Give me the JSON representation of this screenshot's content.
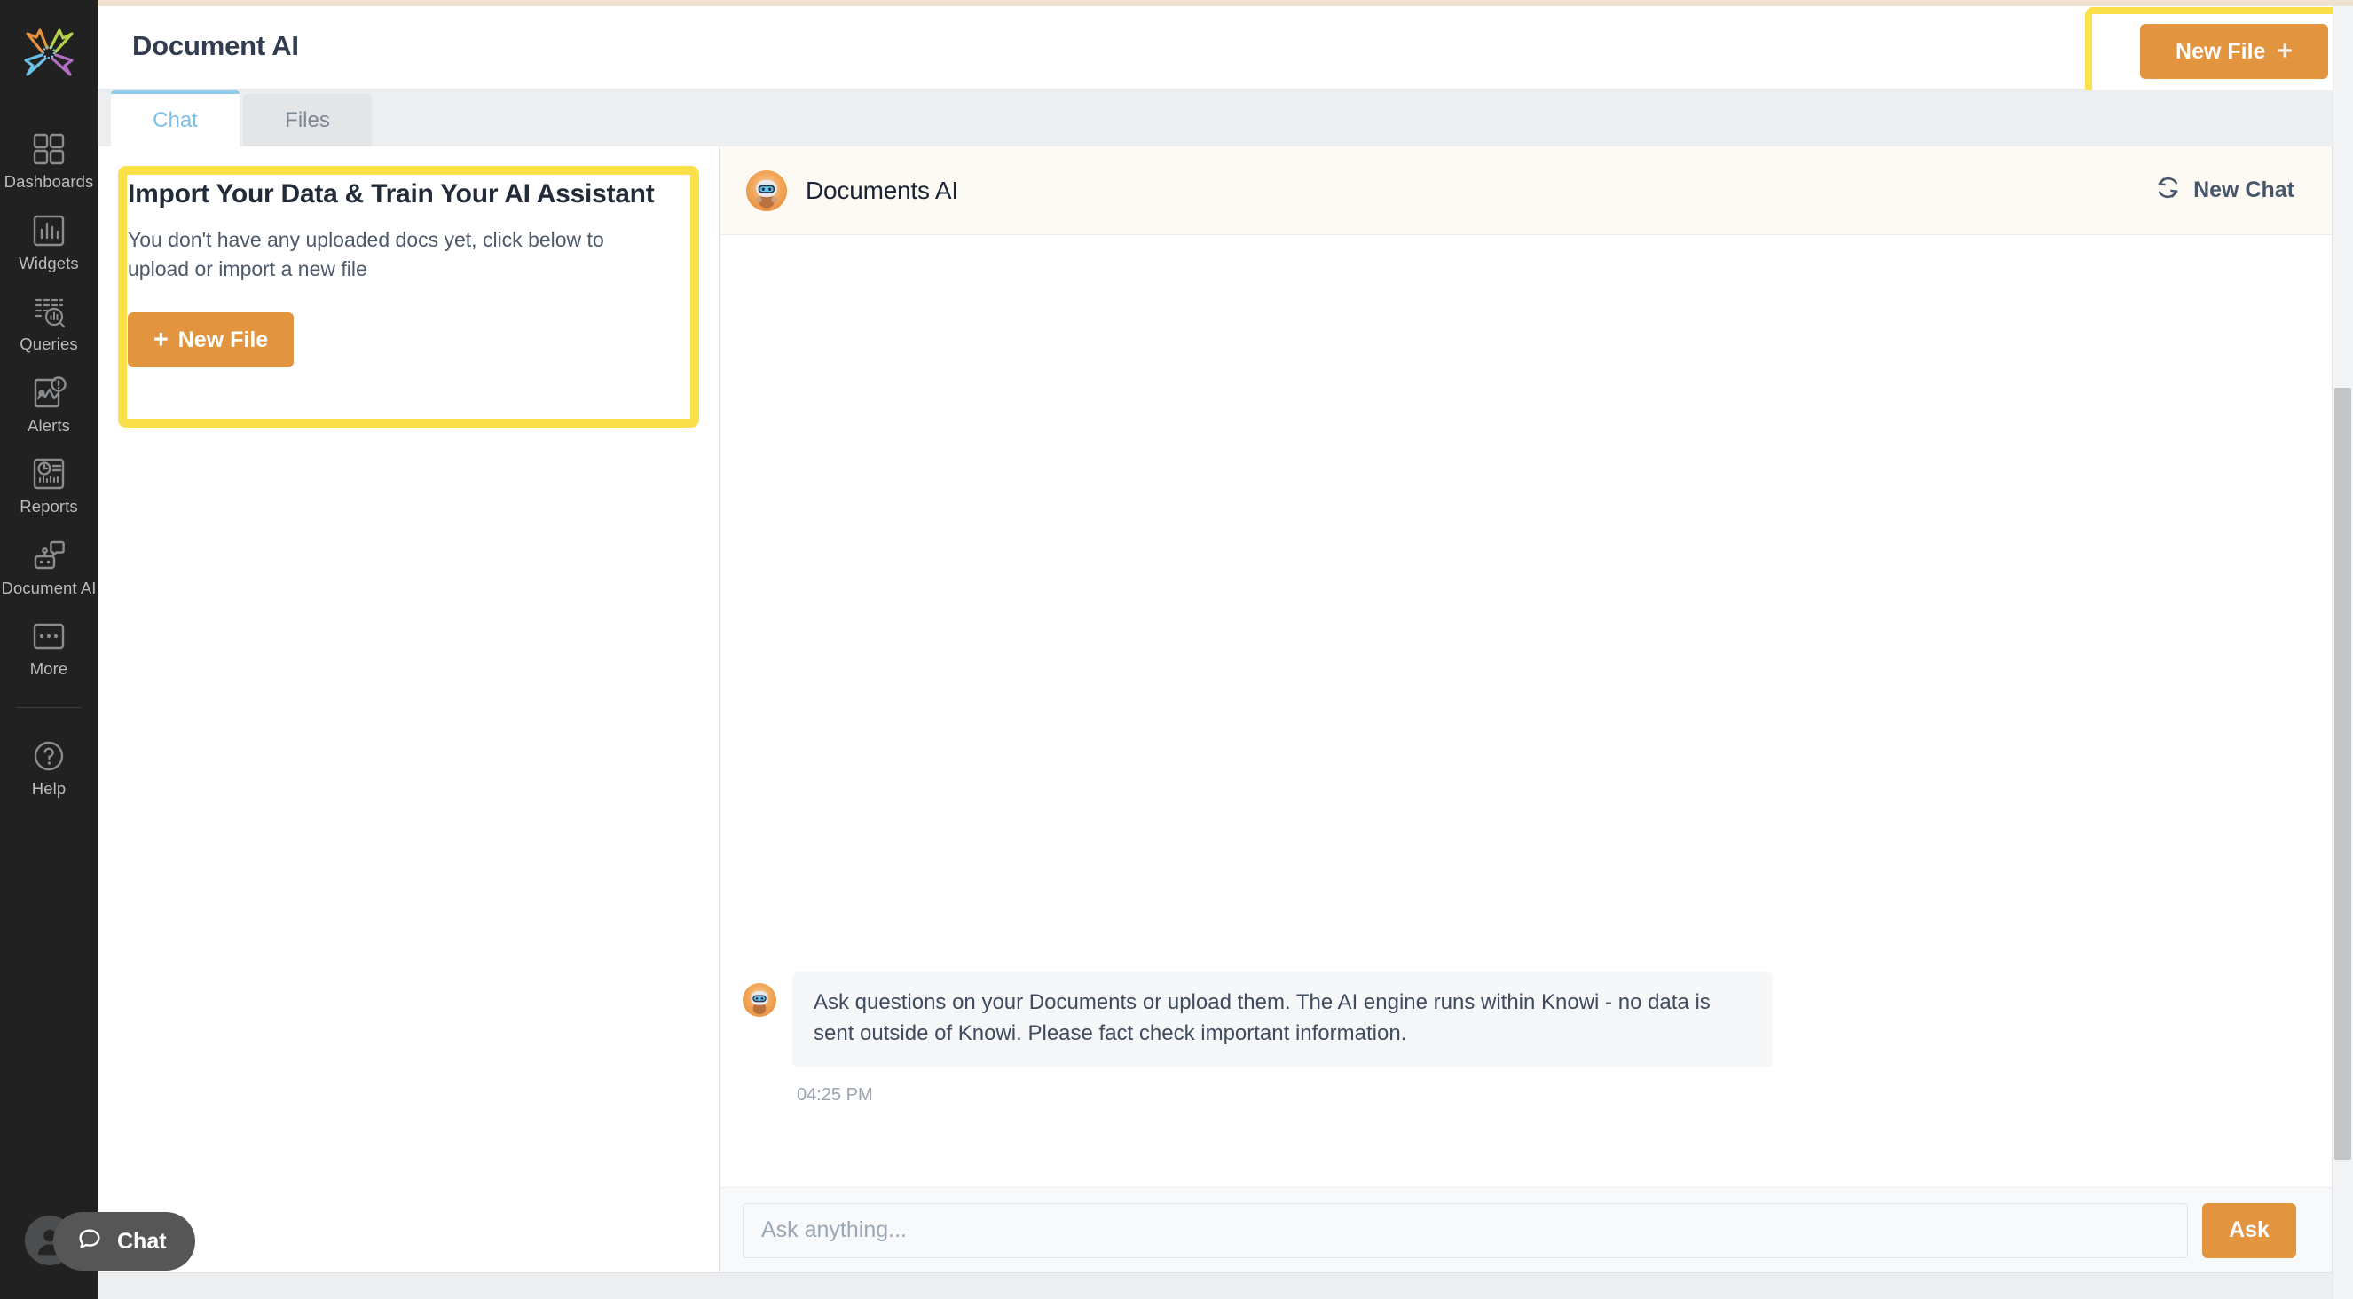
{
  "colors": {
    "accent_orange": "#e2943f",
    "highlight_yellow": "#fae14c",
    "rail_bg": "#212121",
    "active_tab_blue": "#7cc0e6",
    "chat_header_bg": "#fcfaf3",
    "page_bg": "#eceef0"
  },
  "sidebar": {
    "logo_name": "knowi-star-logo",
    "items": [
      {
        "label": "Dashboards",
        "icon": "grid-squares-icon"
      },
      {
        "label": "Widgets",
        "icon": "bar-chart-box-icon"
      },
      {
        "label": "Queries",
        "icon": "data-search-icon"
      },
      {
        "label": "Alerts",
        "icon": "alert-chart-icon"
      },
      {
        "label": "Reports",
        "icon": "clock-report-icon"
      },
      {
        "label": "Document AI",
        "icon": "robot-chat-icon"
      },
      {
        "label": "More",
        "icon": "ellipsis-box-icon"
      },
      {
        "label": "Help",
        "icon": "question-circle-icon"
      }
    ],
    "avatar_icon": "user-avatar-icon"
  },
  "chat_launcher": {
    "label": "Chat",
    "icon": "speech-bubble-icon"
  },
  "header": {
    "title": "Document AI",
    "new_file_label": "New File",
    "new_file_plus": "+"
  },
  "tabs": [
    {
      "label": "Chat",
      "active": true
    },
    {
      "label": "Files",
      "active": false
    }
  ],
  "import_card": {
    "title": "Import Your Data & Train Your AI Assistant",
    "subtitle": "You don't have any uploaded docs yet, click below to upload or import a new file",
    "button_plus": "+",
    "button_label": "New File"
  },
  "chat": {
    "assistant_name": "Documents AI",
    "assistant_avatar": "robot-avatar-icon",
    "new_chat_label": "New Chat",
    "new_chat_icon": "refresh-cycle-icon",
    "messages": [
      {
        "author_avatar": "robot-avatar-icon",
        "text": "Ask questions on your Documents or upload them. The AI engine runs within Knowi - no data is sent outside of Knowi. Please fact check important information.",
        "time": "04:25 PM"
      }
    ],
    "input_placeholder": "Ask anything...",
    "input_value": "",
    "ask_label": "Ask"
  }
}
